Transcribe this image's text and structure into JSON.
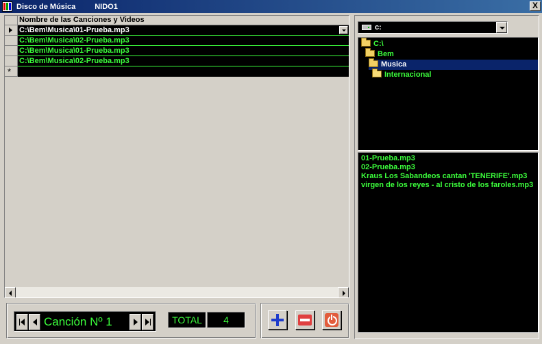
{
  "window": {
    "title": "Disco de Música",
    "subtitle": "NIDO1",
    "close_label": "X"
  },
  "grid": {
    "column_header": "Nombre de las Canciones y Videos",
    "rows": [
      "C:\\Bem\\Musica\\01-Prueba.mp3",
      "C:\\Bem\\Musica\\02-Prueba.mp3",
      "C:\\Bem\\Musica\\01-Prueba.mp3",
      "C:\\Bem\\Musica\\02-Prueba.mp3"
    ],
    "new_row_marker": "*"
  },
  "navigator": {
    "label": "Canción Nº 1"
  },
  "total": {
    "label": "TOTAL",
    "value": "4"
  },
  "drive": {
    "value": "c:"
  },
  "directories": [
    {
      "label": "C:\\",
      "level": 0
    },
    {
      "label": "Bem",
      "level": 1
    },
    {
      "label": "Musica",
      "level": 2,
      "selected": true
    },
    {
      "label": "Internacional",
      "level": 3
    }
  ],
  "files": [
    "01-Prueba.mp3",
    "02-Prueba.mp3",
    "Kraus  Los Sabandeos cantan 'TENERIFE'.mp3",
    "virgen de los reyes - al cristo de los faroles.mp3"
  ],
  "colors": {
    "accent_text": "#3cff3c",
    "list_background": "#000000",
    "selection": "#0a246a"
  }
}
